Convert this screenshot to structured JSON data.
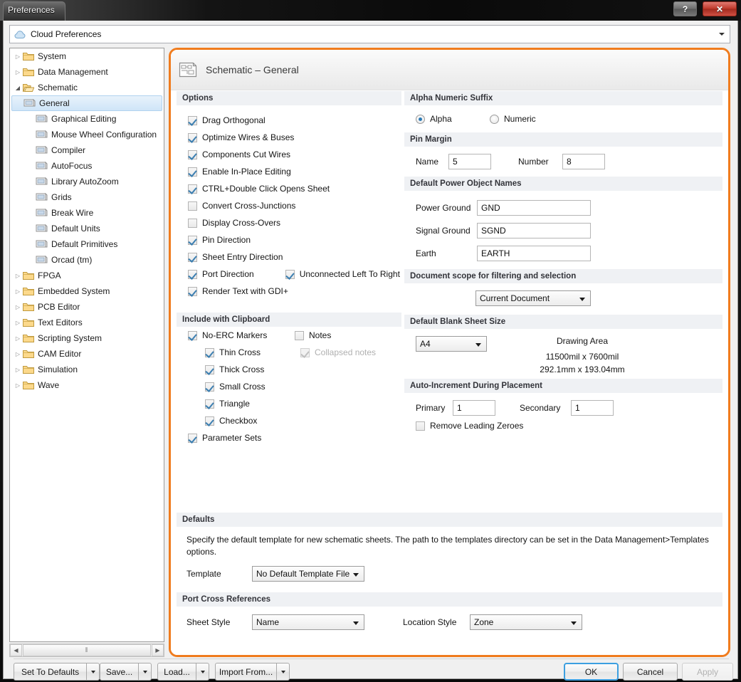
{
  "window": {
    "title": "Preferences",
    "help_button": "?",
    "close_button": "✕"
  },
  "cloud_combo": {
    "value": "Cloud Preferences",
    "icon": "cloud-icon"
  },
  "tree": {
    "items": [
      {
        "label": "System",
        "level": 0,
        "type": "folder",
        "twisty": "collapsed"
      },
      {
        "label": "Data Management",
        "level": 0,
        "type": "folder",
        "twisty": "collapsed"
      },
      {
        "label": "Schematic",
        "level": 0,
        "type": "folder-open",
        "twisty": "expanded"
      },
      {
        "label": "General",
        "level": 1,
        "type": "page",
        "twisty": "none",
        "selected": true
      },
      {
        "label": "Graphical Editing",
        "level": 1,
        "type": "page",
        "twisty": "none"
      },
      {
        "label": "Mouse Wheel Configuration",
        "level": 1,
        "type": "page",
        "twisty": "none"
      },
      {
        "label": "Compiler",
        "level": 1,
        "type": "page",
        "twisty": "none"
      },
      {
        "label": "AutoFocus",
        "level": 1,
        "type": "page",
        "twisty": "none"
      },
      {
        "label": "Library AutoZoom",
        "level": 1,
        "type": "page",
        "twisty": "none"
      },
      {
        "label": "Grids",
        "level": 1,
        "type": "page",
        "twisty": "none"
      },
      {
        "label": "Break Wire",
        "level": 1,
        "type": "page",
        "twisty": "none"
      },
      {
        "label": "Default Units",
        "level": 1,
        "type": "page",
        "twisty": "none"
      },
      {
        "label": "Default Primitives",
        "level": 1,
        "type": "page",
        "twisty": "none"
      },
      {
        "label": "Orcad (tm)",
        "level": 1,
        "type": "page",
        "twisty": "none"
      },
      {
        "label": "FPGA",
        "level": 0,
        "type": "folder",
        "twisty": "collapsed"
      },
      {
        "label": "Embedded System",
        "level": 0,
        "type": "folder",
        "twisty": "collapsed"
      },
      {
        "label": "PCB Editor",
        "level": 0,
        "type": "folder",
        "twisty": "collapsed"
      },
      {
        "label": "Text Editors",
        "level": 0,
        "type": "folder",
        "twisty": "collapsed"
      },
      {
        "label": "Scripting System",
        "level": 0,
        "type": "folder",
        "twisty": "collapsed"
      },
      {
        "label": "CAM Editor",
        "level": 0,
        "type": "folder",
        "twisty": "collapsed"
      },
      {
        "label": "Simulation",
        "level": 0,
        "type": "folder",
        "twisty": "collapsed"
      },
      {
        "label": "Wave",
        "level": 0,
        "type": "folder",
        "twisty": "collapsed"
      }
    ],
    "scrollbar": {
      "left_arrow": "◀",
      "right_arrow": "▶",
      "grip": "⦀"
    }
  },
  "page": {
    "title": "Schematic – General",
    "icon": "schematic-icon"
  },
  "options": {
    "header": "Options",
    "items": [
      {
        "label": "Drag Orthogonal",
        "checked": true
      },
      {
        "label": "Optimize Wires & Buses",
        "checked": true
      },
      {
        "label": "Components Cut Wires",
        "checked": true
      },
      {
        "label": "Enable In-Place Editing",
        "checked": true
      },
      {
        "label": "CTRL+Double Click Opens Sheet",
        "checked": true
      },
      {
        "label": "Convert Cross-Junctions",
        "checked": false
      },
      {
        "label": "Display Cross-Overs",
        "checked": false
      },
      {
        "label": "Pin Direction",
        "checked": true
      },
      {
        "label": "Sheet Entry Direction",
        "checked": true
      },
      {
        "label": "Port Direction",
        "checked": true
      },
      {
        "label": "Render Text with GDI+",
        "checked": true
      }
    ],
    "unconnected_left_to_right": {
      "label": "Unconnected Left To Right",
      "checked": true
    }
  },
  "clipboard": {
    "header": "Include with Clipboard",
    "no_erc_markers": {
      "label": "No-ERC Markers",
      "checked": true
    },
    "sub_items": [
      {
        "label": "Thin Cross",
        "checked": true
      },
      {
        "label": "Thick Cross",
        "checked": true
      },
      {
        "label": "Small Cross",
        "checked": true
      },
      {
        "label": "Triangle",
        "checked": true
      },
      {
        "label": "Checkbox",
        "checked": true
      }
    ],
    "parameter_sets": {
      "label": "Parameter Sets",
      "checked": true
    },
    "notes": {
      "label": "Notes",
      "checked": false
    },
    "collapsed_notes": {
      "label": "Collapsed notes",
      "checked": true,
      "disabled": true
    }
  },
  "alpha_numeric_suffix": {
    "header": "Alpha Numeric Suffix",
    "options": [
      {
        "label": "Alpha",
        "selected": true
      },
      {
        "label": "Numeric",
        "selected": false
      }
    ]
  },
  "pin_margin": {
    "header": "Pin Margin",
    "name_label": "Name",
    "name_value": "5",
    "number_label": "Number",
    "number_value": "8"
  },
  "power_objects": {
    "header": "Default Power Object Names",
    "rows": [
      {
        "label": "Power Ground",
        "value": "GND"
      },
      {
        "label": "Signal Ground",
        "value": "SGND"
      },
      {
        "label": "Earth",
        "value": "EARTH"
      }
    ]
  },
  "document_scope": {
    "header": "Document scope for filtering and selection",
    "value": "Current Document"
  },
  "sheet_size": {
    "header": "Default Blank Sheet Size",
    "value": "A4",
    "drawing_area_label": "Drawing Area",
    "dimensions_mil": "11500mil x 7600mil",
    "dimensions_mm": "292.1mm x 193.04mm"
  },
  "auto_increment": {
    "header": "Auto-Increment During Placement",
    "primary_label": "Primary",
    "primary_value": "1",
    "secondary_label": "Secondary",
    "secondary_value": "1",
    "remove_leading_zeroes": {
      "label": "Remove Leading Zeroes",
      "checked": false
    }
  },
  "defaults": {
    "header": "Defaults",
    "description": "Specify the default template for new schematic sheets.  The path to the templates directory can be set in the Data Management>Templates options.",
    "template_label": "Template",
    "template_value": "No Default Template File"
  },
  "port_cross_refs": {
    "header": "Port Cross References",
    "sheet_style_label": "Sheet Style",
    "sheet_style_value": "Name",
    "location_style_label": "Location Style",
    "location_style_value": "Zone"
  },
  "footer": {
    "set_to_defaults": "Set To Defaults",
    "save": "Save...",
    "load": "Load...",
    "import_from": "Import From...",
    "ok": "OK",
    "cancel": "Cancel",
    "apply": "Apply"
  },
  "colors": {
    "accent_orange": "#f07c1e",
    "focus_blue": "#3c9fe0",
    "check_blue": "#3c7fb1",
    "section_header_bg": "#eff1f4",
    "close_red": "#c0392b"
  }
}
